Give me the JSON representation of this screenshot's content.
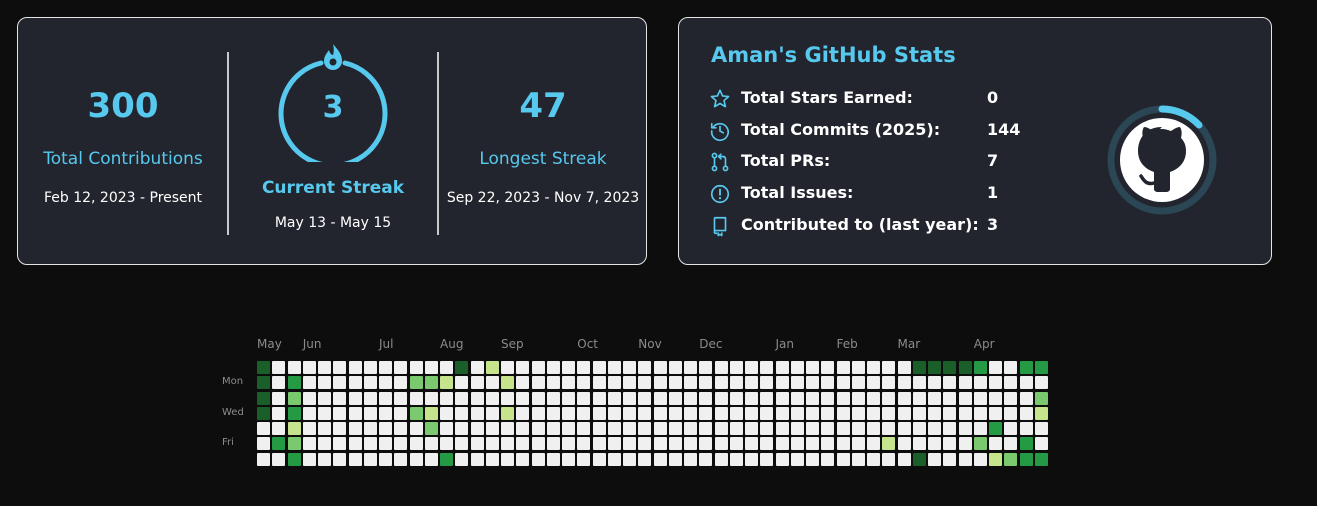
{
  "streak": {
    "total": {
      "value": "300",
      "label": "Total Contributions",
      "range": "Feb 12, 2023 - Present"
    },
    "current": {
      "value": "3",
      "label": "Current Streak",
      "range": "May 13 - May 15"
    },
    "longest": {
      "value": "47",
      "label": "Longest Streak",
      "range": "Sep 22, 2023 - Nov 7, 2023"
    },
    "accent_color": "#58c9ee"
  },
  "stats": {
    "title": "Aman's GitHub Stats",
    "items": [
      {
        "icon": "star-icon",
        "label": "Total Stars Earned:",
        "value": "0"
      },
      {
        "icon": "history-icon",
        "label": "Total Commits (2025):",
        "value": "144"
      },
      {
        "icon": "pull-request-icon",
        "label": "Total PRs:",
        "value": "7"
      },
      {
        "icon": "issue-icon",
        "label": "Total Issues:",
        "value": "1"
      },
      {
        "icon": "repo-icon",
        "label": "Contributed to (last year):",
        "value": "3"
      }
    ],
    "logo": "github-logo-icon"
  },
  "graph": {
    "months": [
      {
        "label": "May",
        "col": 0
      },
      {
        "label": "Jun",
        "col": 3
      },
      {
        "label": "Jul",
        "col": 8
      },
      {
        "label": "Aug",
        "col": 12
      },
      {
        "label": "Sep",
        "col": 16
      },
      {
        "label": "Oct",
        "col": 21
      },
      {
        "label": "Nov",
        "col": 25
      },
      {
        "label": "Dec",
        "col": 29
      },
      {
        "label": "Jan",
        "col": 34
      },
      {
        "label": "Feb",
        "col": 38
      },
      {
        "label": "Mar",
        "col": 42
      },
      {
        "label": "Apr",
        "col": 47
      }
    ],
    "days": [
      {
        "label": "Mon",
        "row": 1
      },
      {
        "label": "Wed",
        "row": 3
      },
      {
        "label": "Fri",
        "row": 5
      }
    ],
    "colors": [
      "#f0f0f0",
      "#c5e48c",
      "#7ac96f",
      "#249a44",
      "#1a5e2a"
    ],
    "levels": [
      "4000000000000401000000000000000000000000000444430033",
      "4030000000221000100000000000000000000000000000000000",
      "4020000000000000000000000000000000000000000000000002",
      "4030000000210000100000000000000000000000000000000001",
      "0010000000020000000000000000000000000000000000003000",
      "0320000000000000000000000000000000000000010000020030",
      "0030000000003000000000000000000000000000000400001233"
    ]
  }
}
